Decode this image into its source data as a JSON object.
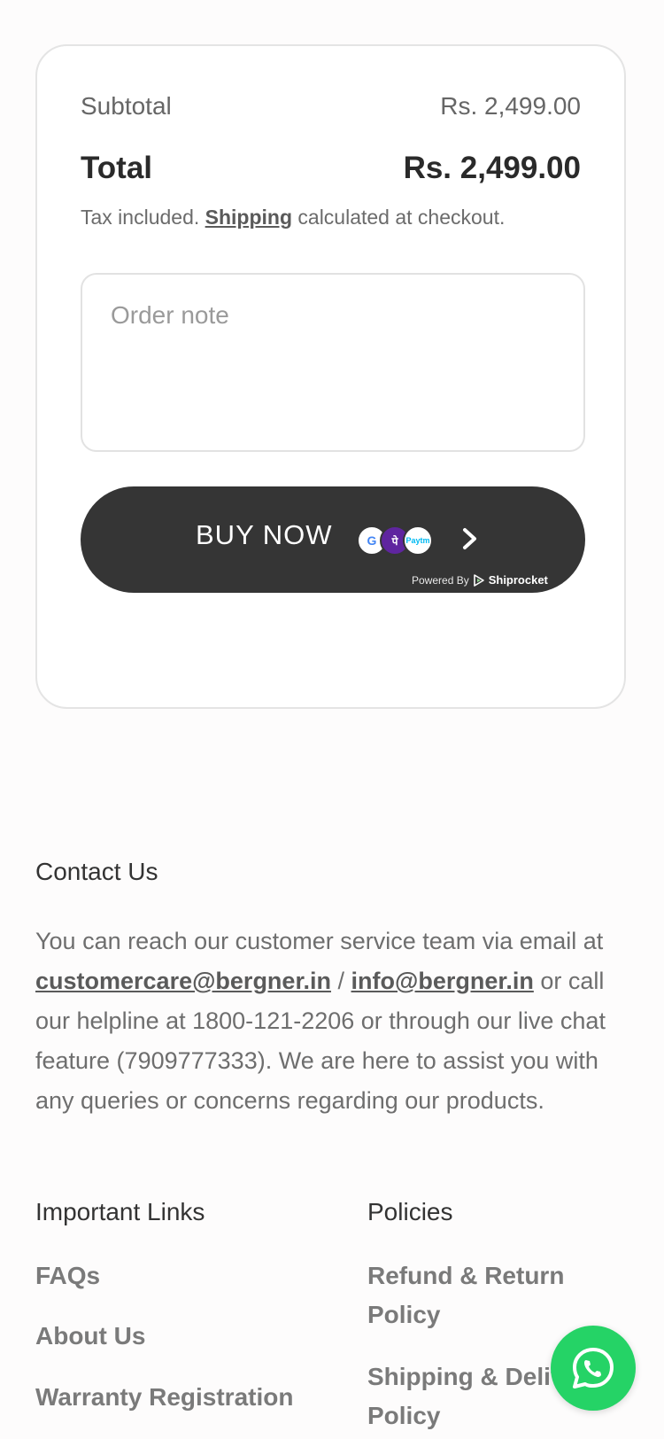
{
  "cart_summary": {
    "subtotal_label": "Subtotal",
    "subtotal_value": "Rs. 2,499.00",
    "total_label": "Total",
    "total_value": "Rs. 2,499.00",
    "tax_prefix": "Tax included.",
    "shipping_link": "Shipping",
    "tax_suffix": "calculated at checkout.",
    "order_note_placeholder": "Order note"
  },
  "buy_button": {
    "label": "BUY NOW",
    "powered_by": "Powered By",
    "brand": "Shiprocket",
    "payment_icons": [
      "google-pay-icon",
      "phonepe-icon",
      "paytm-icon"
    ],
    "paytm_text": "Paytm"
  },
  "contact": {
    "title": "Contact Us",
    "text_1": "You can reach our customer service team via email at",
    "email_1": "customercare@bergner.in",
    "separator": "/",
    "email_2": "info@bergner.in",
    "text_2": "or call our helpline at 1800-121-2206 or through our live chat feature (7909777333). We are here to assist you with any queries or concerns regarding our products."
  },
  "important_links": {
    "title": "Important Links",
    "items": [
      "FAQs",
      "About Us",
      "Warranty Registration"
    ]
  },
  "policies": {
    "title": "Policies",
    "items": [
      "Refund & Return Policy",
      "Shipping & Delivery Policy"
    ]
  },
  "colors": {
    "button_bg": "#353535",
    "whatsapp": "#25d366"
  }
}
